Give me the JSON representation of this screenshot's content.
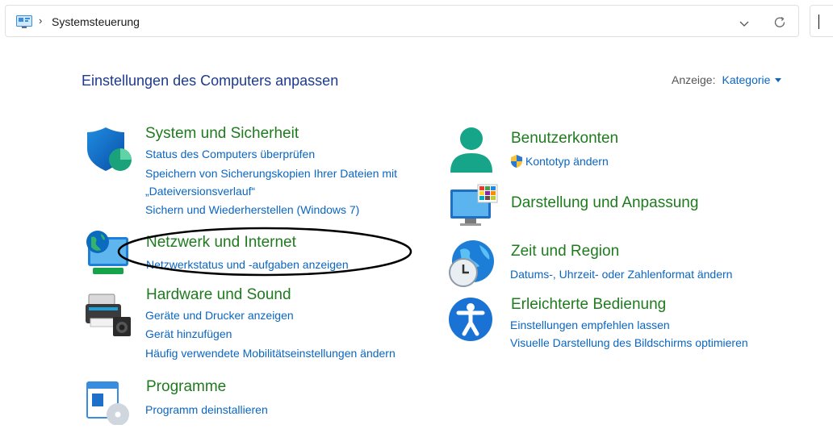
{
  "address": {
    "crumb": "Systemsteuerung"
  },
  "header": {
    "title": "Einstellungen des Computers anpassen",
    "view_label": "Anzeige:",
    "view_value": "Kategorie"
  },
  "left": [
    {
      "title": "System und Sicherheit",
      "links": [
        "Status des Computers überprüfen",
        "Speichern von Sicherungskopien Ihrer Dateien mit",
        "„Dateiversionsverlauf“",
        "Sichern und Wiederherstellen (Windows 7)"
      ]
    },
    {
      "title": "Netzwerk und Internet",
      "links": [
        "Netzwerkstatus und -aufgaben anzeigen"
      ]
    },
    {
      "title": "Hardware und Sound",
      "links": [
        "Geräte und Drucker anzeigen",
        "Gerät hinzufügen",
        "Häufig verwendete Mobilitätseinstellungen ändern"
      ]
    },
    {
      "title": "Programme",
      "links": [
        "Programm deinstallieren"
      ]
    }
  ],
  "right": [
    {
      "title": "Benutzerkonten",
      "links": [
        "Kontotyp ändern"
      ]
    },
    {
      "title": "Darstellung und Anpassung",
      "links": []
    },
    {
      "title": "Zeit und Region",
      "links": [
        "Datums-, Uhrzeit- oder Zahlenformat ändern"
      ]
    },
    {
      "title": "Erleichterte Bedienung",
      "links": [
        "Einstellungen empfehlen lassen",
        "Visuelle Darstellung des Bildschirms optimieren"
      ]
    }
  ],
  "colors": {
    "title_green": "#1e7b1e",
    "link_blue": "#0a66c2",
    "heading_blue": "#1e3a8a"
  }
}
